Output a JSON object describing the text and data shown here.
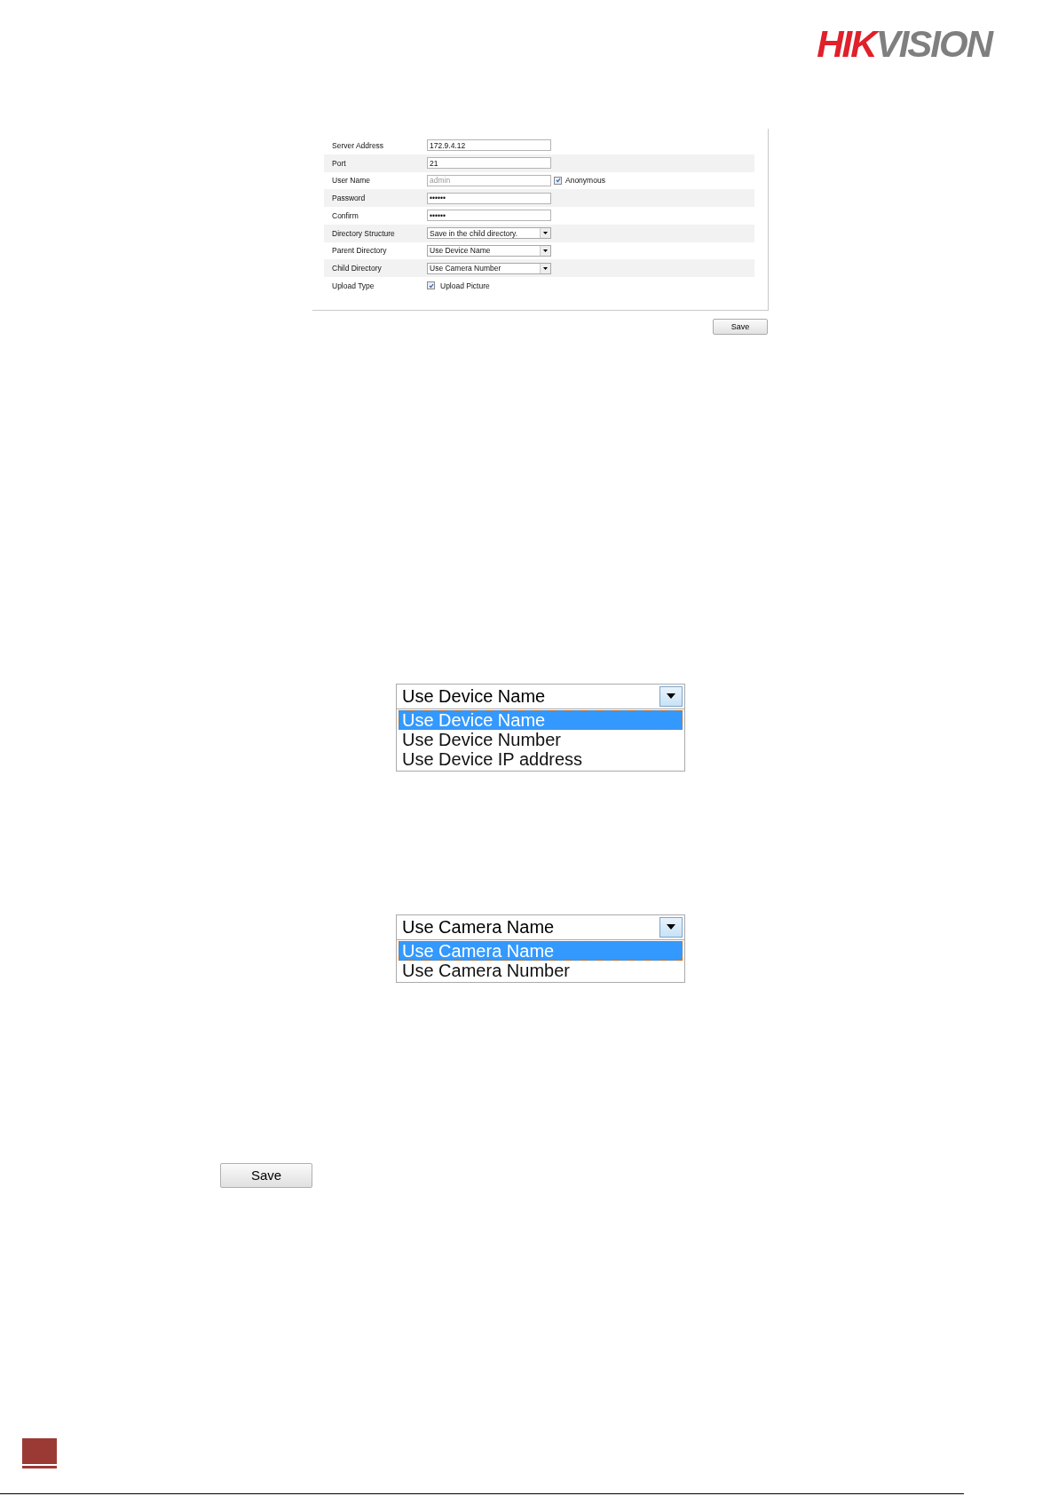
{
  "logo": {
    "parts": [
      {
        "text": "HIK",
        "color": "#e0202a"
      },
      {
        "text": "VISION",
        "color": "#7f7f7f"
      }
    ]
  },
  "ftp_form": {
    "rows": [
      {
        "label": "Server Address",
        "kind": "text",
        "value": "172.9.4.12",
        "disabled": false
      },
      {
        "label": "Port",
        "kind": "text",
        "value": "21",
        "disabled": false
      },
      {
        "label": "User Name",
        "kind": "text",
        "value": "admin",
        "disabled": true,
        "option": {
          "label": "Anonymous",
          "checked": true
        }
      },
      {
        "label": "Password",
        "kind": "text",
        "value": "••••••",
        "disabled": false
      },
      {
        "label": "Confirm",
        "kind": "text",
        "value": "••••••",
        "disabled": false
      },
      {
        "label": "Directory Structure",
        "kind": "select",
        "value": "Save in the child directory."
      },
      {
        "label": "Parent Directory",
        "kind": "select",
        "value": "Use Device Name"
      },
      {
        "label": "Child Directory",
        "kind": "select",
        "value": "Use Camera Number"
      },
      {
        "label": "Upload Type",
        "kind": "checkbox",
        "option": {
          "label": "Upload Picture",
          "checked": true
        }
      }
    ],
    "save": "Save"
  },
  "parent_dropdown": {
    "value": "Use Device Name",
    "options": [
      {
        "label": "Use Device Name",
        "selected": true
      },
      {
        "label": "Use Device Number",
        "selected": false
      },
      {
        "label": "Use Device IP address",
        "selected": false
      }
    ]
  },
  "child_dropdown": {
    "value": "Use Camera Name",
    "options": [
      {
        "label": "Use Camera Name",
        "selected": true
      },
      {
        "label": "Use Camera Number",
        "selected": false
      }
    ]
  },
  "save_button": "Save"
}
